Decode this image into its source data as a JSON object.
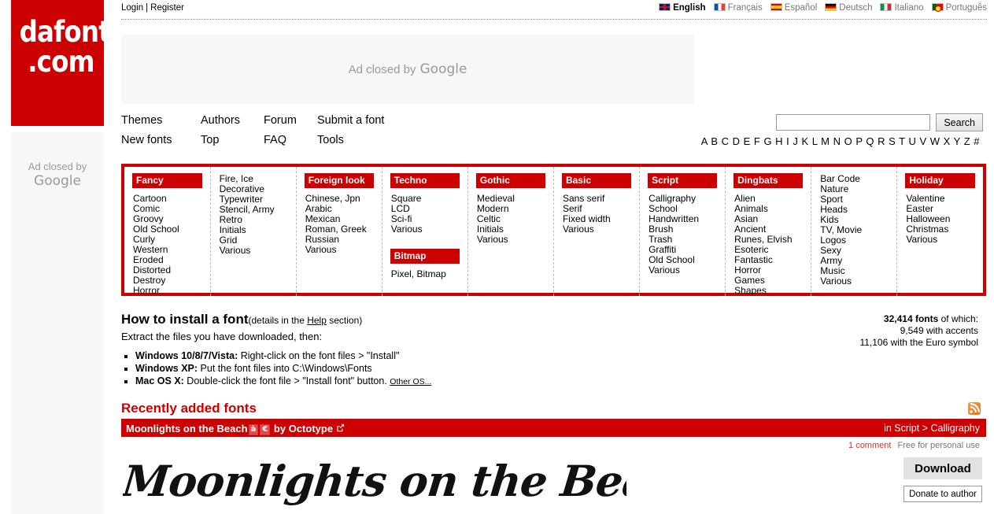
{
  "site": {
    "logo_line1": "dafont",
    "logo_line2": ".com"
  },
  "topbar": {
    "login": "Login",
    "separator": "|",
    "register": "Register",
    "languages": [
      {
        "label": "English",
        "flag": "flag-gb",
        "active": true
      },
      {
        "label": "Français",
        "flag": "flag-fr",
        "active": false
      },
      {
        "label": "Español",
        "flag": "flag-es",
        "active": false
      },
      {
        "label": "Deutsch",
        "flag": "flag-de",
        "active": false
      },
      {
        "label": "Italiano",
        "flag": "flag-it",
        "active": false
      },
      {
        "label": "Português",
        "flag": "flag-pt",
        "active": false
      }
    ]
  },
  "ads": {
    "top_banner": "Ad closed by",
    "top_banner_brand": "Google",
    "left_banner": "Ad closed by",
    "left_banner_brand": "Google"
  },
  "mainnav": {
    "r1c1": "Themes",
    "r1c2": "Authors",
    "r1c3": "Forum",
    "r1c4": "Submit a font",
    "r2c1": "New fonts",
    "r2c2": "Top",
    "r2c3": "FAQ",
    "r2c4": "Tools"
  },
  "search": {
    "value": "",
    "placeholder": "",
    "button": "Search"
  },
  "alphabet": "A B C D E F G H I J K L M N O P Q R S T U V W X Y Z #",
  "categories": [
    {
      "header": "Fancy",
      "items": [
        "Cartoon",
        "Comic",
        "Groovy",
        "Old School",
        "Curly",
        "Western",
        "Eroded",
        "Distorted",
        "Destroy",
        "Horror"
      ]
    },
    {
      "header": null,
      "items": [
        "Fire, Ice",
        "Decorative",
        "Typewriter",
        "Stencil, Army",
        "Retro",
        "Initials",
        "Grid",
        "Various"
      ]
    },
    {
      "header": "Foreign look",
      "items": [
        "Chinese, Jpn",
        "Arabic",
        "Mexican",
        "Roman, Greek",
        "Russian",
        "Various"
      ]
    },
    {
      "header": "Techno",
      "items": [
        "Square",
        "LCD",
        "Sci-fi",
        "Various"
      ],
      "header2": "Bitmap",
      "items2": [
        "Pixel, Bitmap"
      ]
    },
    {
      "header": "Gothic",
      "items": [
        "Medieval",
        "Modern",
        "Celtic",
        "Initials",
        "Various"
      ]
    },
    {
      "header": "Basic",
      "items": [
        "Sans serif",
        "Serif",
        "Fixed width",
        "Various"
      ]
    },
    {
      "header": "Script",
      "items": [
        "Calligraphy",
        "School",
        "Handwritten",
        "Brush",
        "Trash",
        "Graffiti",
        "Old School",
        "Various"
      ]
    },
    {
      "header": "Dingbats",
      "items": [
        "Alien",
        "Animals",
        "Asian",
        "Ancient",
        "Runes, Elvish",
        "Esoteric",
        "Fantastic",
        "Horror",
        "Games",
        "Shapes"
      ]
    },
    {
      "header": null,
      "items": [
        "Bar Code",
        "Nature",
        "Sport",
        "Heads",
        "Kids",
        "TV, Movie",
        "Logos",
        "Sexy",
        "Army",
        "Music",
        "Various"
      ]
    },
    {
      "header": "Holiday",
      "items": [
        "Valentine",
        "Easter",
        "Halloween",
        "Christmas",
        "Various"
      ]
    }
  ],
  "howto": {
    "title": "How to install a font",
    "details_prefix": "(details in the ",
    "details_link": "Help",
    "details_suffix": " section)",
    "extract": "Extract the files you have downloaded, then:",
    "items": [
      {
        "os": "Windows 10/8/7/Vista:",
        "text": " Right-click on the font files > \"Install\""
      },
      {
        "os": "Windows XP:",
        "text": " Put the font files into C:\\Windows\\Fonts"
      },
      {
        "os": "Mac OS X:",
        "text": " Double-click the font file > \"Install font\" button."
      }
    ],
    "other_os": "Other OS..."
  },
  "fontstats": {
    "count": "32,414 fonts",
    "count_suffix": " of which:",
    "accents": "9,549 with accents",
    "euro": "11,106 with the Euro symbol"
  },
  "recent": {
    "heading": "Recently added fonts",
    "rss_icon": "rss-icon",
    "font": {
      "name": "Moonlights on the Beach",
      "badge_accents": "à",
      "badge_euro": "€",
      "by": "by",
      "author": "Octotype",
      "external_icon": "external-link-icon",
      "category": "in Script > Calligraphy",
      "comments": "1 comment",
      "license": "Free for personal use",
      "preview_text": "Moonlights on the Beach",
      "download_label": "Download",
      "donate_label": "Donate to author"
    }
  },
  "colors": {
    "brand_red": "#cc0000",
    "link_blue": "#6f94c4",
    "ad_gray": "#f7f7f7",
    "rss_orange": "#e07820"
  }
}
